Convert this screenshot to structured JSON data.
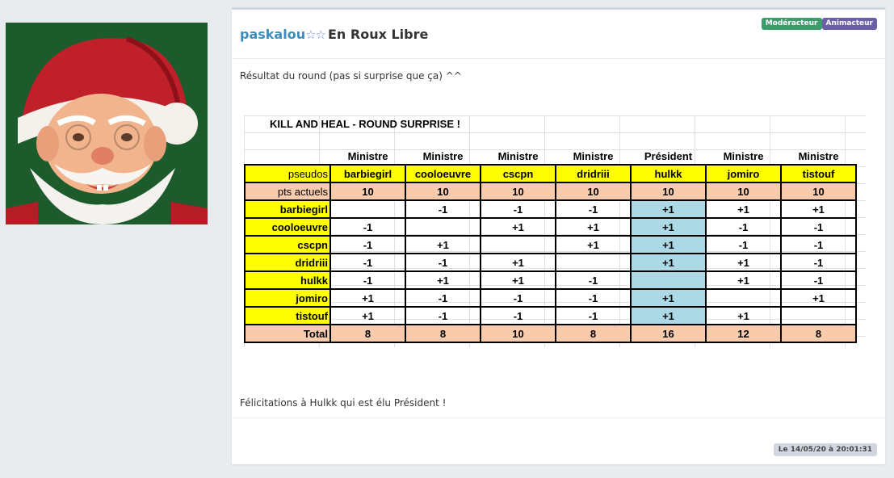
{
  "post": {
    "author": "paskalou",
    "stars": "☆☆",
    "group": "En Roux Libre",
    "badges": [
      "Modéracteur",
      "Animacteur"
    ],
    "text_top": "Résultat du round (pas si surprise que ça) ^^",
    "text_bottom": "Félicitations à Hulkk qui est élu Président !",
    "date": "Le 14/05/20 à 20:01:31"
  },
  "sheet": {
    "title": "KILL AND HEAL - ROUND SURPRISE !",
    "roles": [
      "Ministre",
      "Ministre",
      "Ministre",
      "Ministre",
      "Président",
      "Ministre",
      "Ministre"
    ],
    "pseudos_label": "pseudos",
    "players": [
      "barbiegirl",
      "cooloeuvre",
      "cscpn",
      "dridriii",
      "hulkk",
      "jomiro",
      "tistouf"
    ],
    "pts_label": "pts actuels",
    "pts": [
      "10",
      "10",
      "10",
      "10",
      "10",
      "10",
      "10"
    ],
    "rows": [
      {
        "name": "barbiegirl",
        "cells": [
          "",
          "-1",
          "-1",
          "-1",
          "+1",
          "+1",
          "+1"
        ]
      },
      {
        "name": "cooloeuvre",
        "cells": [
          "-1",
          "",
          "+1",
          "+1",
          "+1",
          "-1",
          "-1"
        ]
      },
      {
        "name": "cscpn",
        "cells": [
          "-1",
          "+1",
          "",
          "+1",
          "+1",
          "-1",
          "-1"
        ]
      },
      {
        "name": "dridriii",
        "cells": [
          "-1",
          "-1",
          "+1",
          "",
          "+1",
          "+1",
          "-1"
        ]
      },
      {
        "name": "hulkk",
        "cells": [
          "-1",
          "+1",
          "+1",
          "-1",
          "",
          "+1",
          "-1"
        ]
      },
      {
        "name": "jomiro",
        "cells": [
          "+1",
          "-1",
          "-1",
          "-1",
          "+1",
          "",
          "+1"
        ]
      },
      {
        "name": "tistouf",
        "cells": [
          "+1",
          "-1",
          "-1",
          "-1",
          "+1",
          "+1",
          ""
        ]
      }
    ],
    "total_label": "Total",
    "totals": [
      "8",
      "8",
      "10",
      "8",
      "16",
      "12",
      "8"
    ]
  }
}
